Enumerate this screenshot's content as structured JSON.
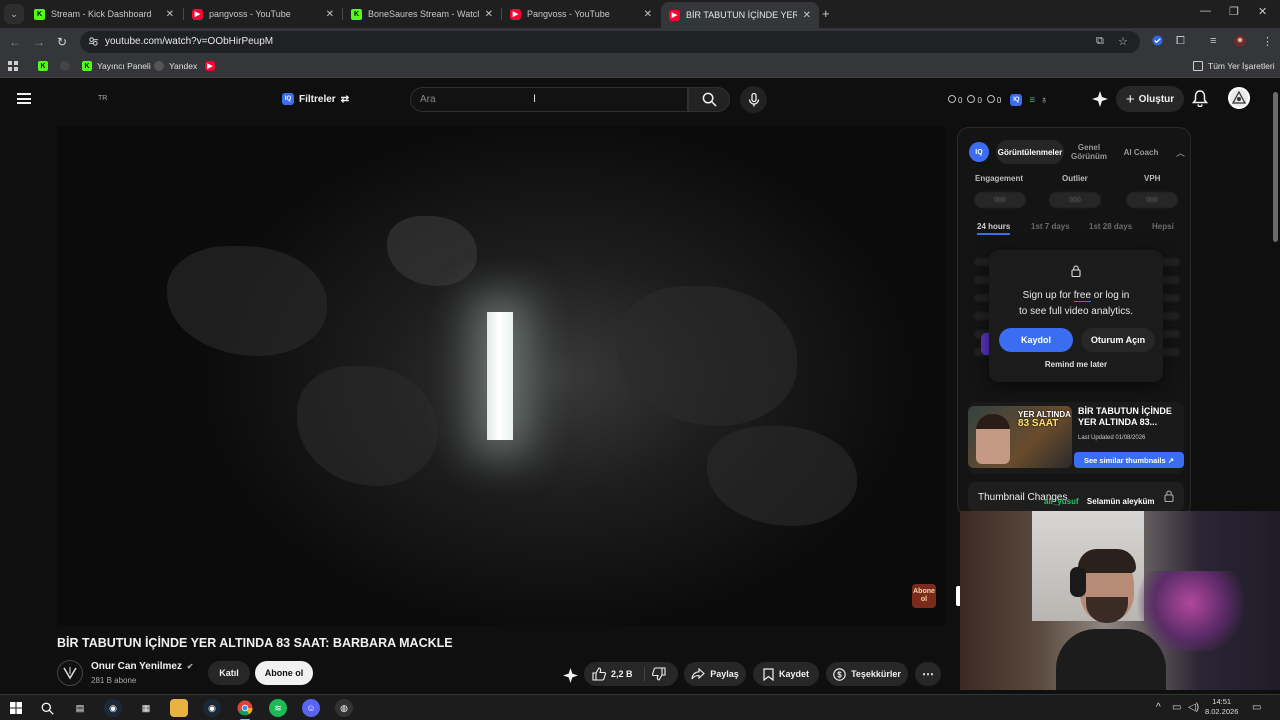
{
  "browser": {
    "tabs": [
      {
        "label": "Stream - Kick Dashboard",
        "icon": "kick-icon"
      },
      {
        "label": "pangvoss - YouTube",
        "icon": "youtube-icon"
      },
      {
        "label": "BoneSaures Stream - Watch Li",
        "icon": "kick-icon"
      },
      {
        "label": "Pangvoss - YouTube",
        "icon": "youtube-icon"
      },
      {
        "label": "BİR TABUTUN İÇİNDE YER ALTIN",
        "icon": "youtube-icon",
        "active": true
      }
    ],
    "url": "youtube.com/watch?v=OObHirPeupM",
    "bookmarks": [
      "Yayıncı Paneli",
      "Yandex"
    ],
    "all_bookmarks": "Tüm Yer İşaretleri"
  },
  "youtube": {
    "region": "TR",
    "filters_label": "Filtreler",
    "search_placeholder": "Ara",
    "ext_counts": [
      "0",
      "0",
      "0"
    ],
    "create_label": "Oluştur",
    "video": {
      "title": "BİR TABUTUN İÇİNDE YER ALTINDA 83 SAAT: BARBARA MACKLE",
      "channel": "Onur Can Yenilmez",
      "subscribers": "281 B abone",
      "join_label": "Katıl",
      "subscribe_label": "Abone ol",
      "like_count": "2,2 B",
      "share_label": "Paylaş",
      "save_label": "Kaydet",
      "thanks_label": "Teşekkürler",
      "overlay_logo": "Abone ol"
    }
  },
  "iq_panel": {
    "logo": "IQ",
    "tabs": [
      "Görüntülenmeler",
      "Genel Görünüm",
      "AI Coach"
    ],
    "metrics": [
      {
        "label": "Engagement",
        "value": "000"
      },
      {
        "label": "Outlier",
        "value": "000"
      },
      {
        "label": "VPH",
        "value": "000"
      }
    ],
    "ranges": [
      "24 hours",
      "1st 7 days",
      "1st 28 days",
      "Hepsi"
    ],
    "lock": {
      "line1_pre": "Sign up for ",
      "line1_free": "free",
      "line1_post": " or log in",
      "line2": "to see full video analytics.",
      "signup_label": "Kaydol",
      "login_label": "Oturum Açın",
      "remind_label": "Remind me later"
    },
    "thumbnail_card": {
      "thumb_text_1": "YER ALTINDA",
      "thumb_text_2": "83 SAAT",
      "title": "BİR TABUTUN İÇİNDE YER ALTINDA 83...",
      "updated": "Last Updated 01/08/2026",
      "similar_label": "See similar thumbnails ↗"
    },
    "thumbnail_changes": "Thumbnail Changes"
  },
  "stream_overlay": {
    "chat_user": "ali_yusuf",
    "chat_message": "Selamün aleyküm"
  },
  "taskbar": {
    "time": "14:51",
    "date": "8.02.2026"
  },
  "colors": {
    "accent_blue": "#3b6df2",
    "kick_green": "#53fc18",
    "youtube_red": "#ff0033",
    "page_bg": "#0f0f0f"
  }
}
